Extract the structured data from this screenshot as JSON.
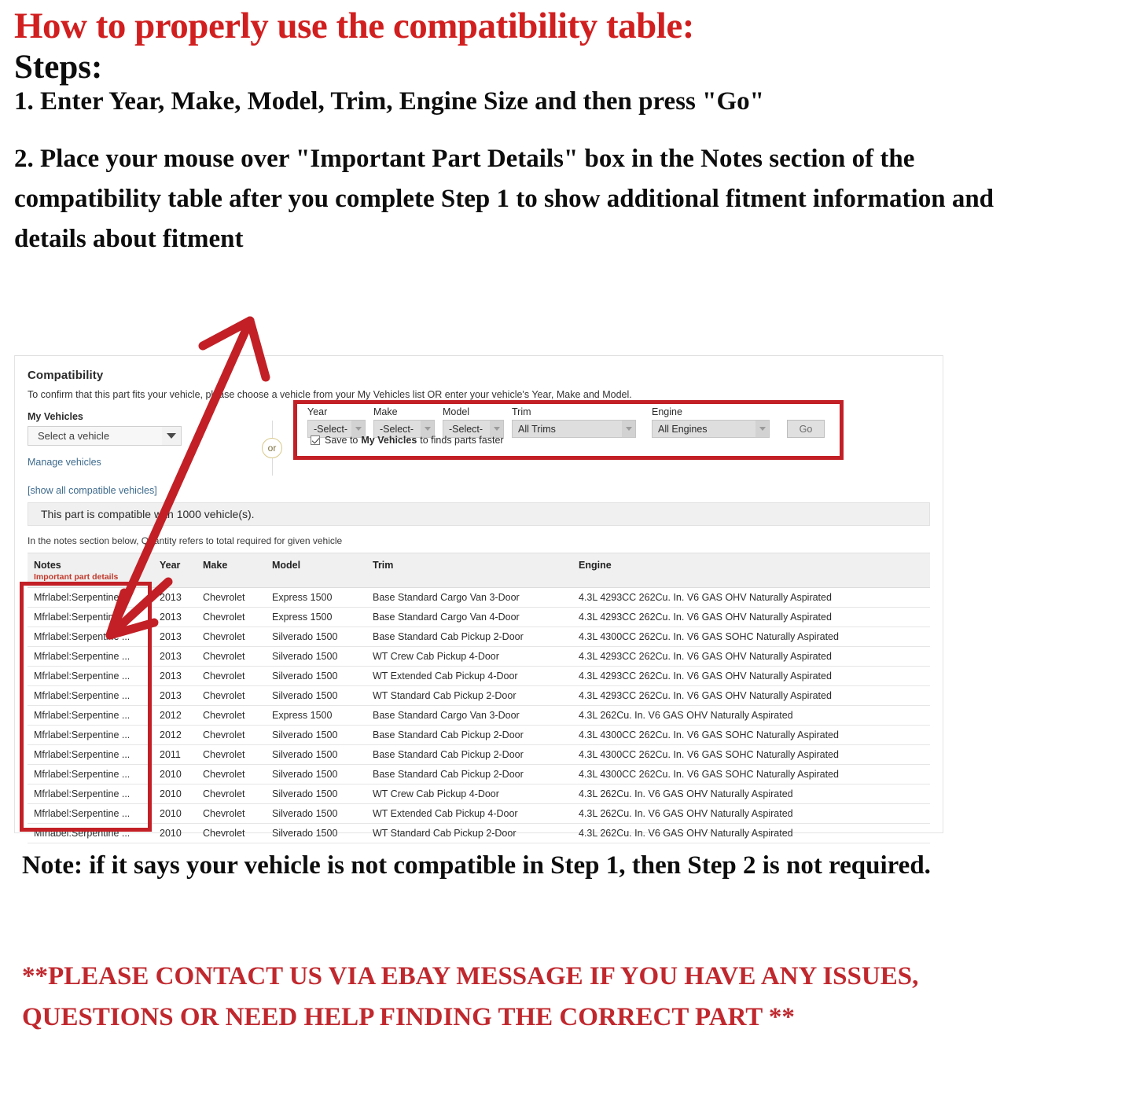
{
  "headline": {
    "title": "How to properly use the compatibility table:",
    "steps_label": "Steps:",
    "step1": "1. Enter Year, Make, Model, Trim, Engine Size and then press \"Go\"",
    "step2": "2. Place your mouse over \"Important Part Details\" box in the Notes section of the compatibility table after you complete Step 1 to show additional fitment information and details about fitment"
  },
  "footer": {
    "note": "Note: if it says your vehicle is not compatible in Step 1, then Step 2 is not required.",
    "contact": "**PLEASE CONTACT US VIA EBAY MESSAGE IF YOU HAVE ANY ISSUES, QUESTIONS OR NEED HELP FINDING THE CORRECT PART **"
  },
  "colors": {
    "headline_red": "#d11f1f",
    "highlight_red": "#c22026",
    "link_blue": "#3e6b8e",
    "footer_red": "#c0282e"
  },
  "panel": {
    "heading": "Compatibility",
    "subtext": "To confirm that this part fits your vehicle, please choose a vehicle from your My Vehicles list OR enter your vehicle's Year, Make and Model.",
    "my_vehicles": {
      "label": "My Vehicles",
      "select_value": "Select a vehicle",
      "manage_link": "Manage vehicles",
      "show_all_link": "[show all compatible vehicles]"
    },
    "or_label": "or",
    "ymm_form": {
      "year": {
        "label": "Year",
        "value": "-Select-"
      },
      "make": {
        "label": "Make",
        "value": "-Select-"
      },
      "model": {
        "label": "Model",
        "value": "-Select-"
      },
      "trim": {
        "label": "Trim",
        "value": "All Trims"
      },
      "engine": {
        "label": "Engine",
        "value": "All Engines"
      },
      "go_button": "Go",
      "save_checkbox": {
        "checked": true,
        "text_before": "Save to",
        "text_bold": "My Vehicles",
        "text_after": "to finds parts faster"
      }
    },
    "count_bar": "This part is compatible with 1000 vehicle(s).",
    "qty_note": "In the notes section below, Quantity refers to total required for given vehicle",
    "table": {
      "headers": {
        "notes": "Notes",
        "notes_sub": "Important part details",
        "year": "Year",
        "make": "Make",
        "model": "Model",
        "trim": "Trim",
        "engine": "Engine"
      },
      "rows": [
        {
          "notes": "Mfrlabel:Serpentine ...",
          "year": "2013",
          "make": "Chevrolet",
          "model": "Express 1500",
          "trim": "Base Standard Cargo Van 3-Door",
          "engine": "4.3L 4293CC 262Cu. In. V6 GAS OHV Naturally Aspirated"
        },
        {
          "notes": "Mfrlabel:Serpentine ...",
          "year": "2013",
          "make": "Chevrolet",
          "model": "Express 1500",
          "trim": "Base Standard Cargo Van 4-Door",
          "engine": "4.3L 4293CC 262Cu. In. V6 GAS OHV Naturally Aspirated"
        },
        {
          "notes": "Mfrlabel:Serpentine ...",
          "year": "2013",
          "make": "Chevrolet",
          "model": "Silverado 1500",
          "trim": "Base Standard Cab Pickup 2-Door",
          "engine": "4.3L 4300CC 262Cu. In. V6 GAS SOHC Naturally Aspirated"
        },
        {
          "notes": "Mfrlabel:Serpentine ...",
          "year": "2013",
          "make": "Chevrolet",
          "model": "Silverado 1500",
          "trim": "WT Crew Cab Pickup 4-Door",
          "engine": "4.3L 4293CC 262Cu. In. V6 GAS OHV Naturally Aspirated"
        },
        {
          "notes": "Mfrlabel:Serpentine ...",
          "year": "2013",
          "make": "Chevrolet",
          "model": "Silverado 1500",
          "trim": "WT Extended Cab Pickup 4-Door",
          "engine": "4.3L 4293CC 262Cu. In. V6 GAS OHV Naturally Aspirated"
        },
        {
          "notes": "Mfrlabel:Serpentine ...",
          "year": "2013",
          "make": "Chevrolet",
          "model": "Silverado 1500",
          "trim": "WT Standard Cab Pickup 2-Door",
          "engine": "4.3L 4293CC 262Cu. In. V6 GAS OHV Naturally Aspirated"
        },
        {
          "notes": "Mfrlabel:Serpentine ...",
          "year": "2012",
          "make": "Chevrolet",
          "model": "Express 1500",
          "trim": "Base Standard Cargo Van 3-Door",
          "engine": "4.3L 262Cu. In. V6 GAS OHV Naturally Aspirated"
        },
        {
          "notes": "Mfrlabel:Serpentine ...",
          "year": "2012",
          "make": "Chevrolet",
          "model": "Silverado 1500",
          "trim": "Base Standard Cab Pickup 2-Door",
          "engine": "4.3L 4300CC 262Cu. In. V6 GAS SOHC Naturally Aspirated"
        },
        {
          "notes": "Mfrlabel:Serpentine ...",
          "year": "2011",
          "make": "Chevrolet",
          "model": "Silverado 1500",
          "trim": "Base Standard Cab Pickup 2-Door",
          "engine": "4.3L 4300CC 262Cu. In. V6 GAS SOHC Naturally Aspirated"
        },
        {
          "notes": "Mfrlabel:Serpentine ...",
          "year": "2010",
          "make": "Chevrolet",
          "model": "Silverado 1500",
          "trim": "Base Standard Cab Pickup 2-Door",
          "engine": "4.3L 4300CC 262Cu. In. V6 GAS SOHC Naturally Aspirated"
        },
        {
          "notes": "Mfrlabel:Serpentine ...",
          "year": "2010",
          "make": "Chevrolet",
          "model": "Silverado 1500",
          "trim": "WT Crew Cab Pickup 4-Door",
          "engine": "4.3L 262Cu. In. V6 GAS OHV Naturally Aspirated"
        },
        {
          "notes": "Mfrlabel:Serpentine ...",
          "year": "2010",
          "make": "Chevrolet",
          "model": "Silverado 1500",
          "trim": "WT Extended Cab Pickup 4-Door",
          "engine": "4.3L 262Cu. In. V6 GAS OHV Naturally Aspirated"
        },
        {
          "notes": "Mfrlabel:Serpentine ...",
          "year": "2010",
          "make": "Chevrolet",
          "model": "Silverado 1500",
          "trim": "WT Standard Cab Pickup 2-Door",
          "engine": "4.3L 262Cu. In. V6 GAS OHV Naturally Aspirated"
        }
      ]
    }
  }
}
